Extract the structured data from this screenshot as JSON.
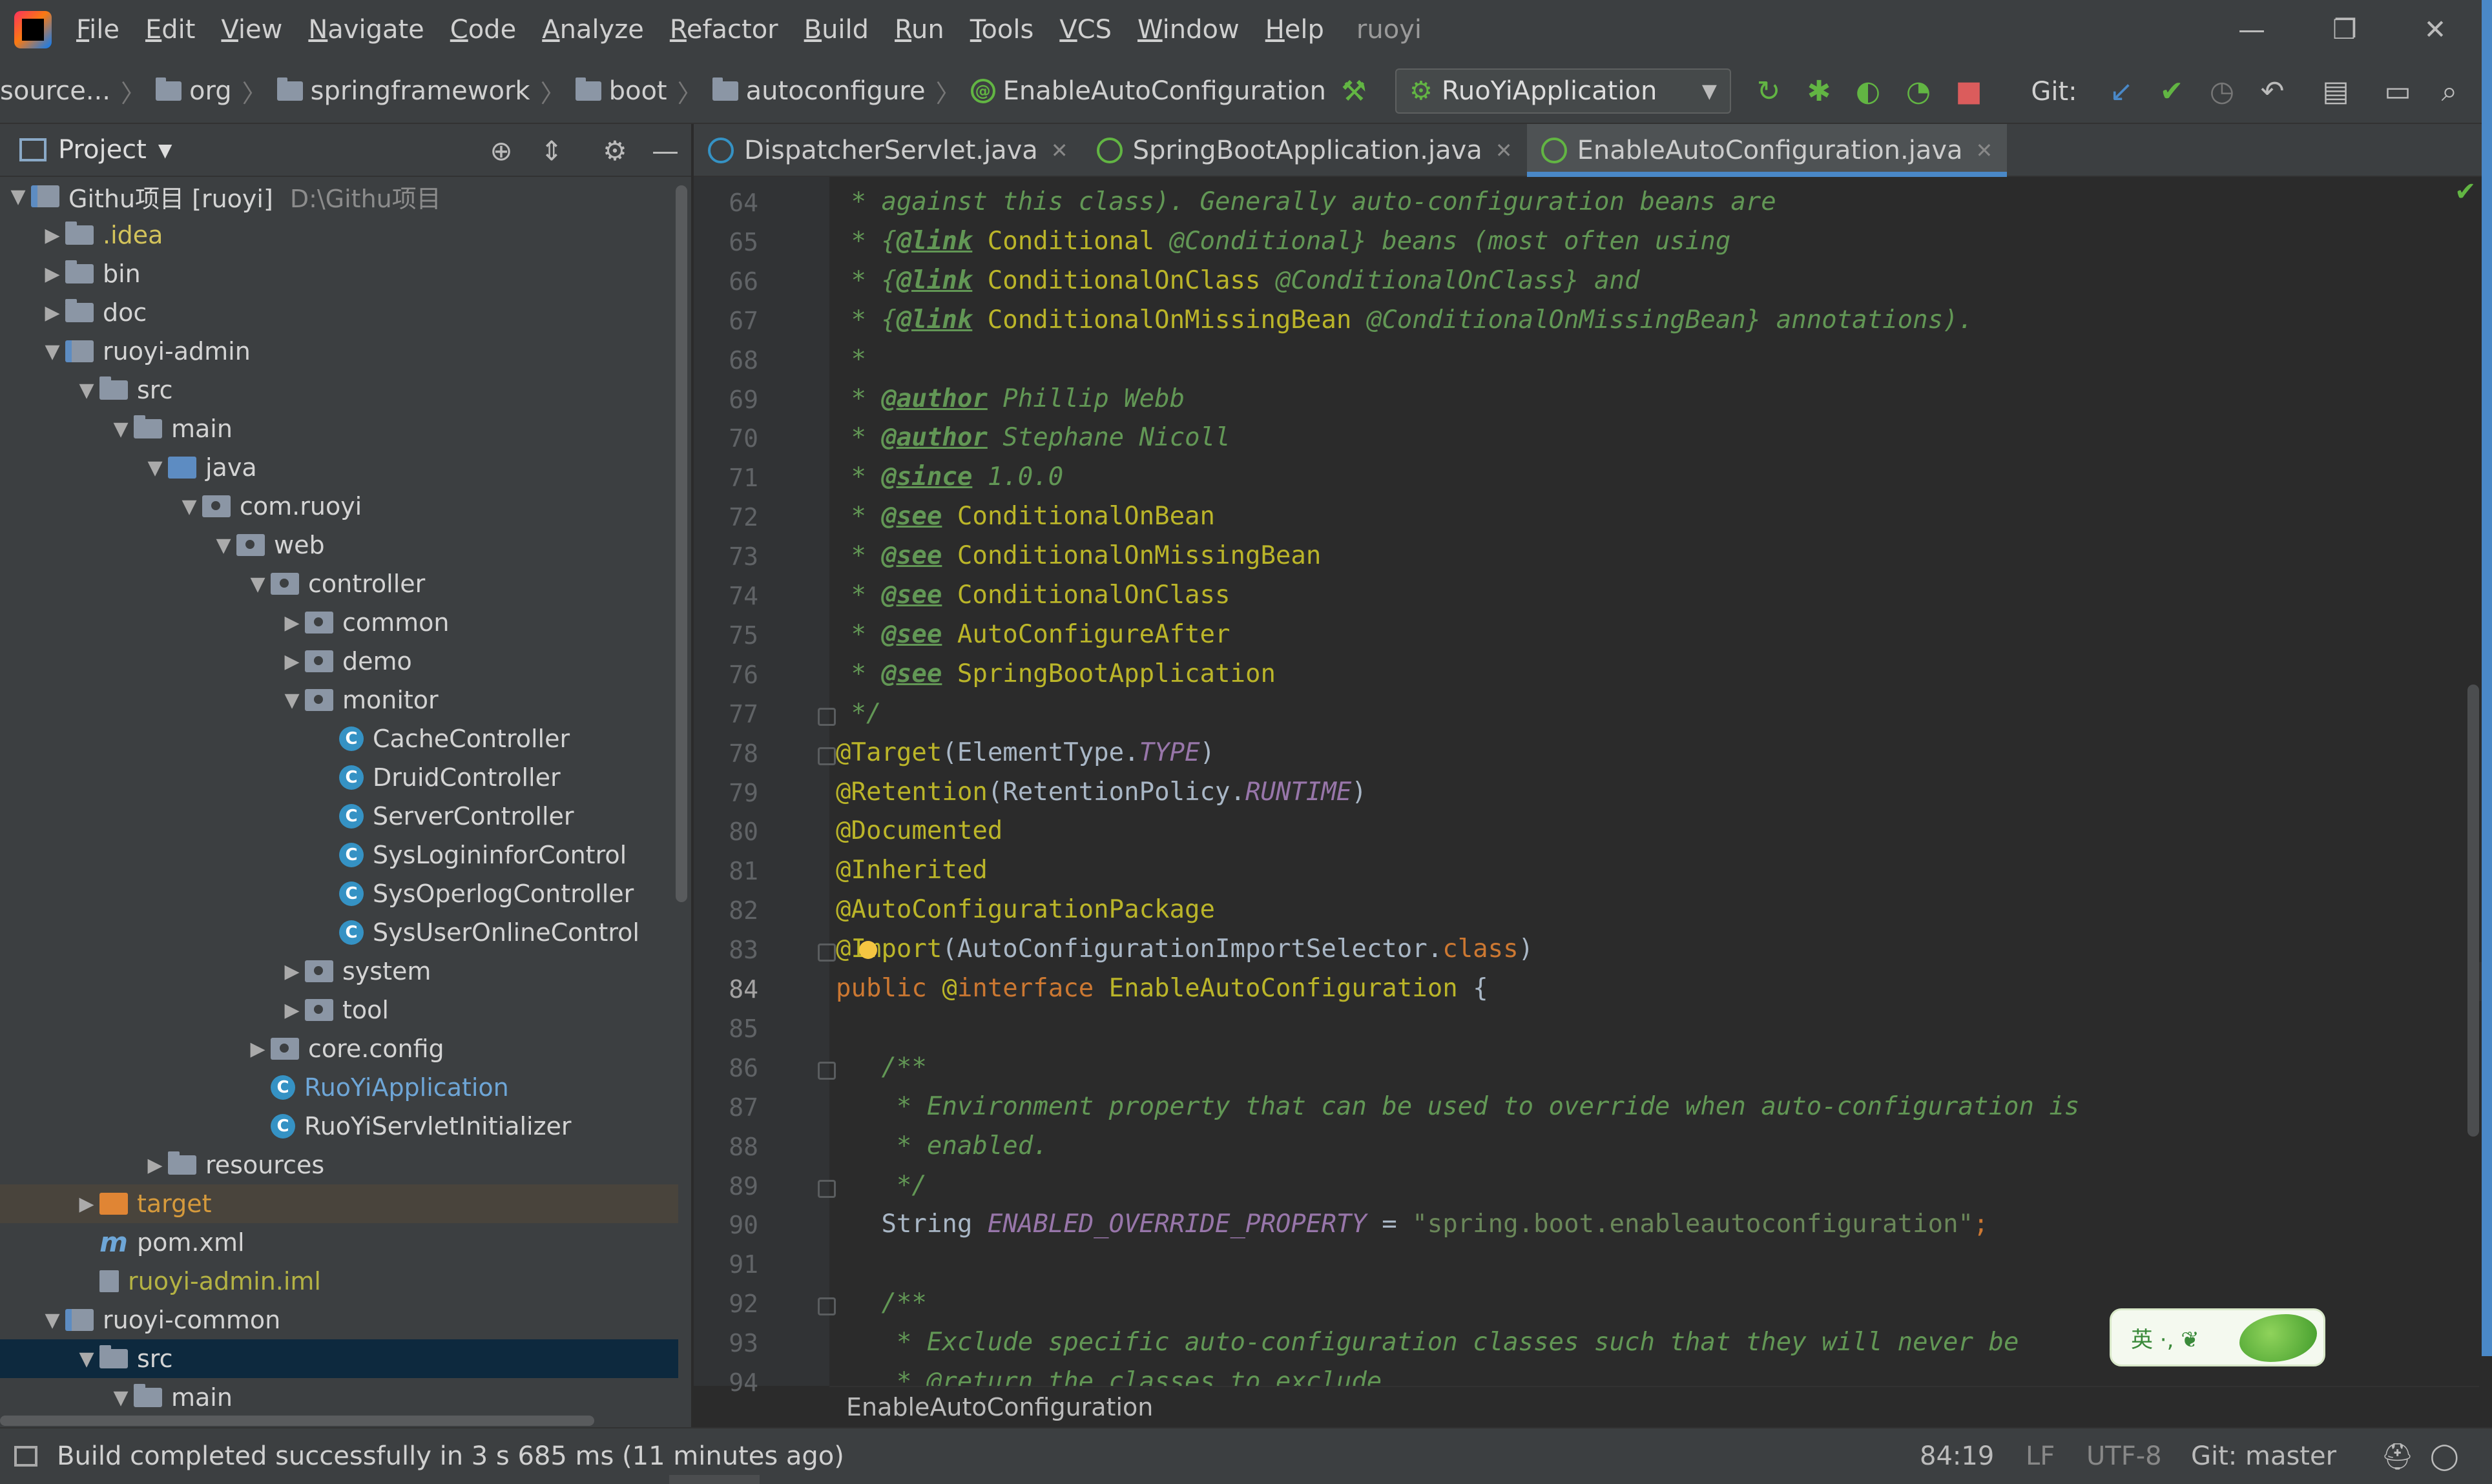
{
  "window": {
    "title": "ruoyi"
  },
  "menu": [
    "File",
    "Edit",
    "View",
    "Navigate",
    "Code",
    "Analyze",
    "Refactor",
    "Build",
    "Run",
    "Tools",
    "VCS",
    "Window",
    "Help"
  ],
  "window_controls": {
    "minimize": "—",
    "restore": "❐",
    "close": "✕"
  },
  "breadcrumb": [
    "source...",
    "org",
    "springframework",
    "boot",
    "autoconfigure",
    "EnableAutoConfiguration"
  ],
  "toolbar": {
    "run_config": "RuoYiApplication",
    "git_label": "Git:"
  },
  "project_panel": {
    "title": "Project",
    "tree": [
      {
        "arrow": "▼",
        "label": "Githu项目 [ruoyi]",
        "extra": "D:\\Githu项目",
        "icon": "module",
        "indent": 0
      },
      {
        "arrow": "▶",
        "label": ".idea",
        "icon": "folder",
        "indent": 1,
        "color": "#d3c35b"
      },
      {
        "arrow": "▶",
        "label": "bin",
        "icon": "folder",
        "indent": 1
      },
      {
        "arrow": "▶",
        "label": "doc",
        "icon": "folder",
        "indent": 1
      },
      {
        "arrow": "▼",
        "label": "ruoyi-admin",
        "icon": "module",
        "indent": 1
      },
      {
        "arrow": "▼",
        "label": "src",
        "icon": "folder",
        "indent": 2
      },
      {
        "arrow": "▼",
        "label": "main",
        "icon": "folder",
        "indent": 3
      },
      {
        "arrow": "▼",
        "label": "java",
        "icon": "src",
        "indent": 4
      },
      {
        "arrow": "▼",
        "label": "com.ruoyi",
        "icon": "pkg",
        "indent": 5
      },
      {
        "arrow": "▼",
        "label": "web",
        "icon": "pkg",
        "indent": 6
      },
      {
        "arrow": "▼",
        "label": "controller",
        "icon": "pkg",
        "indent": 7
      },
      {
        "arrow": "▶",
        "label": "common",
        "icon": "pkg",
        "indent": 8
      },
      {
        "arrow": "▶",
        "label": "demo",
        "icon": "pkg",
        "indent": 8
      },
      {
        "arrow": "▼",
        "label": "monitor",
        "icon": "pkg",
        "indent": 8
      },
      {
        "arrow": "",
        "label": "CacheController",
        "icon": "class",
        "indent": 9
      },
      {
        "arrow": "",
        "label": "DruidController",
        "icon": "class",
        "indent": 9
      },
      {
        "arrow": "",
        "label": "ServerController",
        "icon": "class",
        "indent": 9
      },
      {
        "arrow": "",
        "label": "SysLogininforControl",
        "icon": "class",
        "indent": 9
      },
      {
        "arrow": "",
        "label": "SysOperlogController",
        "icon": "class",
        "indent": 9
      },
      {
        "arrow": "",
        "label": "SysUserOnlineControl",
        "icon": "class",
        "indent": 9
      },
      {
        "arrow": "▶",
        "label": "system",
        "icon": "pkg",
        "indent": 8
      },
      {
        "arrow": "▶",
        "label": "tool",
        "icon": "pkg",
        "indent": 8
      },
      {
        "arrow": "▶",
        "label": "core.config",
        "icon": "pkg",
        "indent": 7
      },
      {
        "arrow": "",
        "label": "RuoYiApplication",
        "icon": "class",
        "indent": 7,
        "color": "#6ea6d7"
      },
      {
        "arrow": "",
        "label": "RuoYiServletInitializer",
        "icon": "class",
        "indent": 7
      },
      {
        "arrow": "▶",
        "label": "resources",
        "icon": "folder",
        "indent": 4
      },
      {
        "arrow": "▶",
        "label": "target",
        "icon": "target",
        "indent": 2,
        "color": "#d69a3c",
        "highlight": "target"
      },
      {
        "arrow": "",
        "label": "pom.xml",
        "icon": "maven",
        "indent": 2
      },
      {
        "arrow": "",
        "label": "ruoyi-admin.iml",
        "icon": "iml",
        "indent": 2,
        "color": "#b4b243"
      },
      {
        "arrow": "▼",
        "label": "ruoyi-common",
        "icon": "module",
        "indent": 1
      },
      {
        "arrow": "▼",
        "label": "src",
        "icon": "folder",
        "indent": 2,
        "highlight": "selected"
      },
      {
        "arrow": "▼",
        "label": "main",
        "icon": "folder",
        "indent": 3
      }
    ]
  },
  "editor": {
    "tabs": [
      {
        "label": "DispatcherServlet.java",
        "active": false
      },
      {
        "label": "SpringBootApplication.java",
        "active": false
      },
      {
        "label": "EnableAutoConfiguration.java",
        "active": true
      }
    ],
    "current_line": 84,
    "breadcrumb": "EnableAutoConfiguration",
    "lines": [
      {
        "n": 64,
        "segs": [
          [
            " * against this class). Generally auto-configuration beans are",
            "cm"
          ]
        ]
      },
      {
        "n": 65,
        "segs": [
          [
            " * {",
            "cm"
          ],
          [
            "@link",
            "tag"
          ],
          [
            " Conditional ",
            "an"
          ],
          [
            "@Conditional} beans (most often using",
            "cm"
          ]
        ]
      },
      {
        "n": 66,
        "segs": [
          [
            " * {",
            "cm"
          ],
          [
            "@link",
            "tag"
          ],
          [
            " ConditionalOnClass ",
            "an"
          ],
          [
            "@ConditionalOnClass} and",
            "cm"
          ]
        ]
      },
      {
        "n": 67,
        "segs": [
          [
            " * {",
            "cm"
          ],
          [
            "@link",
            "tag"
          ],
          [
            " ConditionalOnMissingBean ",
            "an"
          ],
          [
            "@ConditionalOnMissingBean} annotations).",
            "cm"
          ]
        ]
      },
      {
        "n": 68,
        "segs": [
          [
            " *",
            "cm"
          ]
        ]
      },
      {
        "n": 69,
        "segs": [
          [
            " * ",
            "cm"
          ],
          [
            "@author",
            "tag"
          ],
          [
            " Phillip Webb",
            "cm"
          ]
        ]
      },
      {
        "n": 70,
        "segs": [
          [
            " * ",
            "cm"
          ],
          [
            "@author",
            "tag"
          ],
          [
            " Stephane Nicoll",
            "cm"
          ]
        ]
      },
      {
        "n": 71,
        "segs": [
          [
            " * ",
            "cm"
          ],
          [
            "@since",
            "tag"
          ],
          [
            " 1.0.0",
            "cm"
          ]
        ]
      },
      {
        "n": 72,
        "segs": [
          [
            " * ",
            "cm"
          ],
          [
            "@see",
            "tag"
          ],
          [
            " ConditionalOnBean",
            "an"
          ]
        ]
      },
      {
        "n": 73,
        "segs": [
          [
            " * ",
            "cm"
          ],
          [
            "@see",
            "tag"
          ],
          [
            " ConditionalOnMissingBean",
            "an"
          ]
        ]
      },
      {
        "n": 74,
        "segs": [
          [
            " * ",
            "cm"
          ],
          [
            "@see",
            "tag"
          ],
          [
            " ConditionalOnClass",
            "an"
          ]
        ]
      },
      {
        "n": 75,
        "segs": [
          [
            " * ",
            "cm"
          ],
          [
            "@see",
            "tag"
          ],
          [
            " AutoConfigureAfter",
            "an"
          ]
        ]
      },
      {
        "n": 76,
        "segs": [
          [
            " * ",
            "cm"
          ],
          [
            "@see",
            "tag"
          ],
          [
            " SpringBootApplication",
            "an"
          ]
        ]
      },
      {
        "n": 77,
        "segs": [
          [
            " */",
            "cm"
          ]
        ]
      },
      {
        "n": 78,
        "segs": [
          [
            "@Target",
            "an"
          ],
          [
            "(ElementType.",
            ""
          ],
          [
            "TYPE",
            "cn"
          ],
          [
            ")",
            ""
          ]
        ]
      },
      {
        "n": 79,
        "segs": [
          [
            "@Retention",
            "an"
          ],
          [
            "(RetentionPolicy.",
            ""
          ],
          [
            "RUNTIME",
            "cn"
          ],
          [
            ")",
            ""
          ]
        ]
      },
      {
        "n": 80,
        "segs": [
          [
            "@Documented",
            "an"
          ]
        ]
      },
      {
        "n": 81,
        "segs": [
          [
            "@Inherited",
            "an"
          ]
        ]
      },
      {
        "n": 82,
        "segs": [
          [
            "@AutoConfigurationPackage",
            "an"
          ]
        ]
      },
      {
        "n": 83,
        "segs": [
          [
            "@Import",
            "an"
          ],
          [
            "(AutoConfigurationImportSelector.",
            ""
          ],
          [
            "class",
            "kw"
          ],
          [
            ")",
            ""
          ]
        ]
      },
      {
        "n": 84,
        "segs": [
          [
            "public ",
            "kw"
          ],
          [
            "@",
            "an"
          ],
          [
            "interface ",
            "kw"
          ],
          [
            "EnableAutoConfiguration",
            "an"
          ],
          [
            " {",
            ""
          ]
        ]
      },
      {
        "n": 85,
        "segs": []
      },
      {
        "n": 86,
        "segs": [
          [
            "   /**",
            "cm"
          ]
        ]
      },
      {
        "n": 87,
        "segs": [
          [
            "    * Environment property that can be used to override when auto-configuration is",
            "cm"
          ]
        ]
      },
      {
        "n": 88,
        "segs": [
          [
            "    * enabled.",
            "cm"
          ]
        ]
      },
      {
        "n": 89,
        "segs": [
          [
            "    */",
            "cm"
          ]
        ]
      },
      {
        "n": 90,
        "segs": [
          [
            "   String ",
            ""
          ],
          [
            "ENABLED_OVERRIDE_PROPERTY",
            "cn"
          ],
          [
            " = ",
            ""
          ],
          [
            "\"spring.boot.enableautoconfiguration\"",
            "str"
          ],
          [
            ";",
            "kw"
          ]
        ]
      },
      {
        "n": 91,
        "segs": []
      },
      {
        "n": 92,
        "segs": [
          [
            "   /**",
            "cm"
          ]
        ]
      },
      {
        "n": 93,
        "segs": [
          [
            "    * Exclude specific auto-configuration classes such that they will never be",
            "cm"
          ]
        ]
      },
      {
        "n": 94,
        "segs": [
          [
            "    * @return the classes to exclude",
            "cm"
          ]
        ]
      }
    ]
  },
  "ime": {
    "label": "英 ·, ❦"
  },
  "statusbar": {
    "message": "Build completed successfully in 3 s 685 ms (11 minutes ago)",
    "position": "84:19",
    "line_sep": "LF",
    "encoding": "UTF-8",
    "vcs": "Git: master"
  },
  "colors": {
    "accent": "#4a88c7",
    "background": "#2b2b2b",
    "panel": "#3c3f41",
    "selection": "#0d293e"
  }
}
